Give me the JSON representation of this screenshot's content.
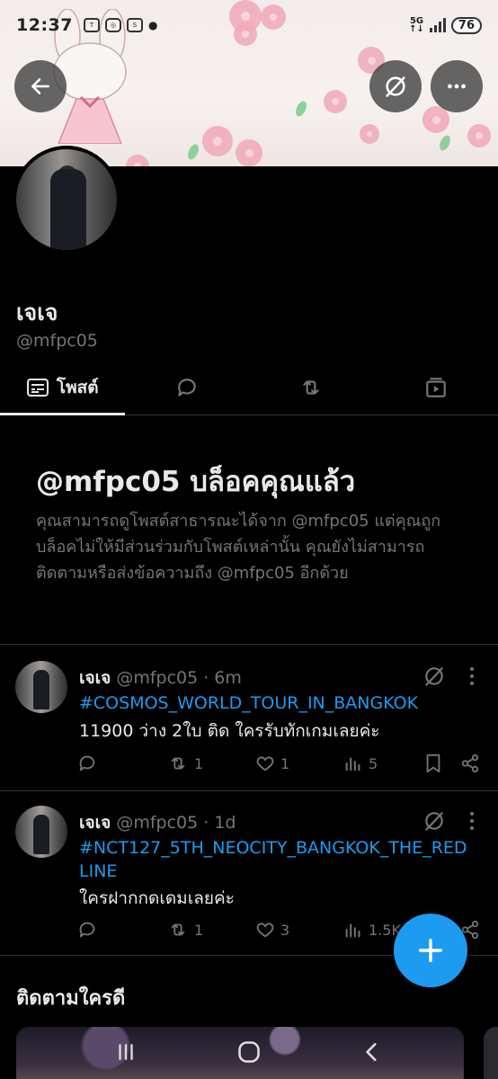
{
  "status_bar": {
    "time": "12:37",
    "notification_icons": [
      "talk-icon",
      "instagram-icon",
      "shopee-icon"
    ],
    "network": "5G",
    "battery": "76"
  },
  "profile": {
    "display_name": "เจเจ",
    "handle": "@mfpc05"
  },
  "tabs": [
    {
      "label": "โพสต์",
      "icon": "posts-icon",
      "active": true
    },
    {
      "label": "",
      "icon": "reply-icon",
      "active": false
    },
    {
      "label": "",
      "icon": "repost-icon",
      "active": false
    },
    {
      "label": "",
      "icon": "media-icon",
      "active": false
    }
  ],
  "blocked_notice": {
    "title": "@mfpc05 บล็อคคุณแล้ว",
    "description": "คุณสามารถดูโพสต์สาธารณะได้จาก @mfpc05 แต่คุณถูกบล็อคไม่ให้มีส่วนร่วมกับโพสต์เหล่านั้น คุณยังไม่สามารถติดตามหรือส่งข้อความถึง @mfpc05 อีกด้วย"
  },
  "posts": [
    {
      "name": "เจเจ",
      "handle_time": "@mfpc05 · 6m",
      "hashtag": "#COSMOS_WORLD_TOUR_IN_BANGKOK",
      "text": "11900 ว่าง 2ใบ ติด ใครรับทักเกมเลยค่ะ",
      "replies": "",
      "reposts": "1",
      "likes": "1",
      "views": "5"
    },
    {
      "name": "เจเจ",
      "handle_time": "@mfpc05 · 1d",
      "hashtag": "#NCT127_5TH_NEOCITY_BANGKOK_THE_RED LINE",
      "text": "ใครฝากกดเดมเลยค่ะ",
      "replies": "",
      "reposts": "1",
      "likes": "3",
      "views": "1.5K"
    }
  ],
  "who_to_follow": {
    "title": "ติดตามใครดี"
  },
  "colors": {
    "accent": "#1d9bf0",
    "background": "#000000",
    "text_primary": "#e7e9ea",
    "text_secondary": "#71767b"
  }
}
